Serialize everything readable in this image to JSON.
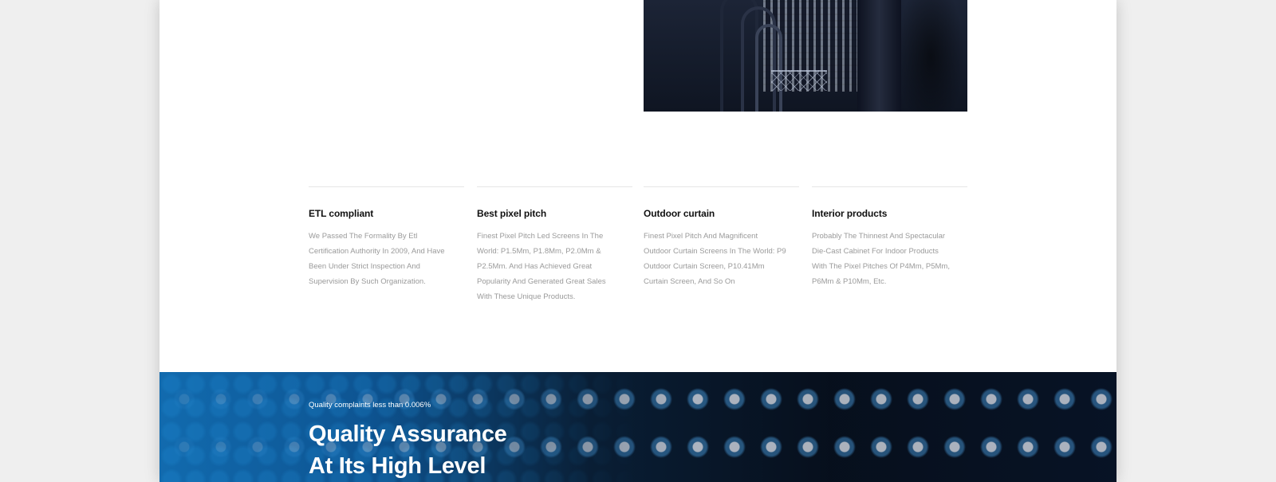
{
  "features": [
    {
      "title": "ETL compliant",
      "description": "We Passed The Formality By Etl Certification Authority In 2009, And Have Been Under Strict Inspection And Supervision By Such Organization."
    },
    {
      "title": "Best pixel pitch",
      "description": "Finest Pixel Pitch Led Screens In The World: P1.5Mm, P1.8Mm, P2.0Mm & P2.5Mm. And Has Achieved Great Popularity And Generated Great Sales With These Unique Products."
    },
    {
      "title": "Outdoor curtain",
      "description": "Finest Pixel Pitch And Magnificent Outdoor Curtain Screens In The World: P9 Outdoor Curtain Screen, P10.41Mm Curtain Screen, And So On"
    },
    {
      "title": "Interior products",
      "description": "Probably The Thinnest And Spectacular Die-Cast Cabinet For Indoor Products With The Pixel Pitches Of P4Mm, P5Mm, P6Mm & P10Mm, Etc."
    }
  ],
  "quality_banner": {
    "tagline": "Quality complaints less than 0.006%",
    "heading_line1": "Quality Assurance",
    "heading_line2": "At Its High Level"
  }
}
